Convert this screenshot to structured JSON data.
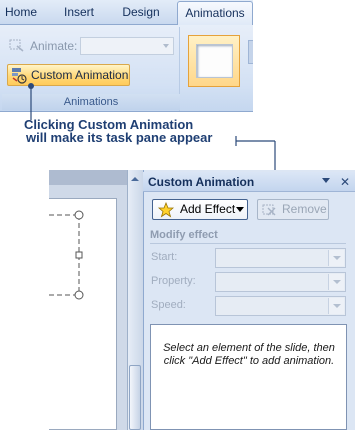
{
  "ribbon": {
    "tabs": [
      "Home",
      "Insert",
      "Design",
      "Animations"
    ],
    "animate_label": "Animate:",
    "custom_animation_label": "Custom Animation",
    "group_label": "Animations"
  },
  "callout": {
    "line1": "Clicking Custom Animation",
    "line2": "will make its task pane appear"
  },
  "task_pane": {
    "title": "Custom Animation",
    "close_glyph": "✕",
    "add_effect_label": "Add Effect",
    "remove_label": "Remove",
    "modify_heading": "Modify effect",
    "fields": {
      "start_label": "Start:",
      "property_label": "Property:",
      "speed_label": "Speed:"
    },
    "hint": "Select an element of the slide, then click \"Add Effect\" to add animation."
  },
  "colors": {
    "callout_text": "#1f3f73",
    "callout_line": "#2c4a7a",
    "highlight_button": "#ffd97a"
  },
  "icons": [
    "animate-icon",
    "custom-animation-icon",
    "add-effect-star-icon",
    "remove-icon",
    "pane-menu-icon",
    "close-icon"
  ]
}
